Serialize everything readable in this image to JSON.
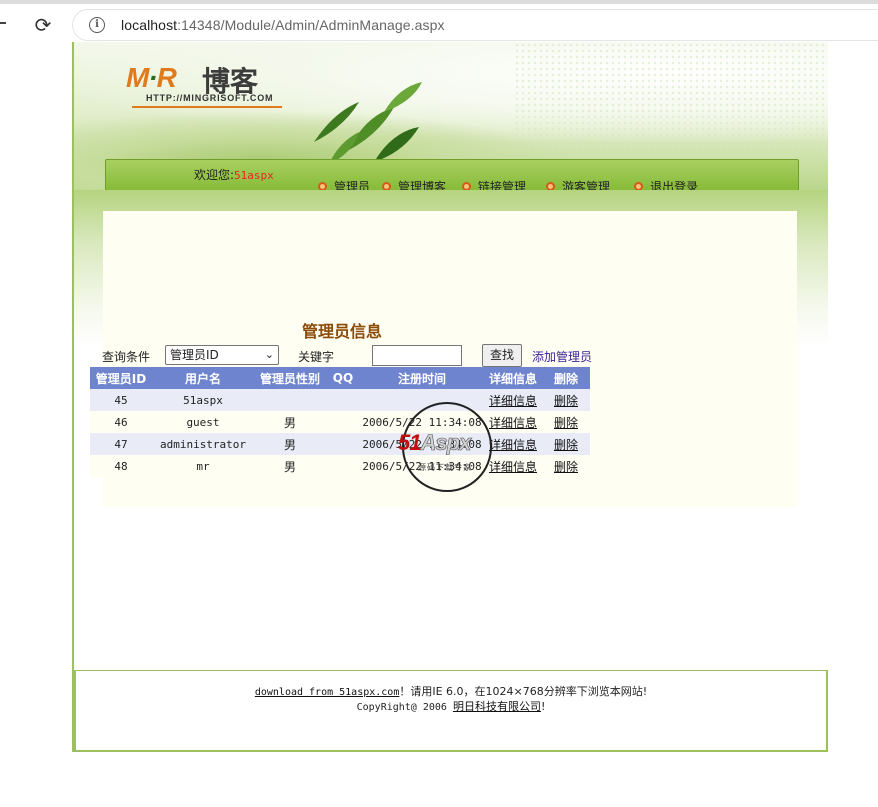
{
  "browser": {
    "url_host": "localhost",
    "url_rest": ":14348/Module/Admin/AdminManage.aspx"
  },
  "logo": {
    "mr_left": "M",
    "mr_dot": "·",
    "mr_right": "R",
    "blog": "博客",
    "site": "HTTP://MINGRISOFT.COM"
  },
  "header": {
    "welcome_label": "欢迎您:",
    "username": "51aspx",
    "nav": [
      "管理员",
      "管理博客",
      "链接管理",
      "游客管理",
      "退出登录"
    ]
  },
  "main": {
    "section_title": "管理员信息",
    "query_label": "查询条件",
    "query_select_value": "管理员ID",
    "keyword_label": "关键字",
    "keyword_value": "",
    "find_button": "查找",
    "add_link": "添加管理员"
  },
  "table": {
    "headers": [
      "管理员ID",
      "用户名",
      "管理员性别",
      "QQ",
      "注册时间",
      "详细信息",
      "删除"
    ],
    "rows": [
      {
        "id": "45",
        "username": "51aspx",
        "gender": "",
        "qq": "",
        "registered": "",
        "detail": "详细信息",
        "delete": "删除"
      },
      {
        "id": "46",
        "username": "guest",
        "gender": "男",
        "qq": "",
        "registered": "2006/5/22 11:34:08",
        "detail": "详细信息",
        "delete": "删除"
      },
      {
        "id": "47",
        "username": "administrator",
        "gender": "男",
        "qq": "",
        "registered": "2006/5/22 11:34:08",
        "detail": "详细信息",
        "delete": "删除"
      },
      {
        "id": "48",
        "username": "mr",
        "gender": "男",
        "qq": "",
        "registered": "2006/5/22 11:34:08",
        "detail": "详细信息",
        "delete": "删除"
      }
    ]
  },
  "watermark": {
    "brand_51": "51",
    "brand_aspx": "Aspx",
    "sub": "源码下载专家"
  },
  "footer": {
    "download_link": "download from 51aspx.com",
    "line1_rest": "！请用IE 6.0，在1024×768分辨率下浏览本网站!",
    "copyright_prefix": "CopyRight@ 2006 ",
    "company_link": "明日科技有限公司",
    "copyright_suffix": "!"
  },
  "colors": {
    "accent_green": "#86bb38",
    "table_header": "#6f84cf",
    "title_brown": "#8a4a08",
    "username_red": "#ee2222"
  }
}
